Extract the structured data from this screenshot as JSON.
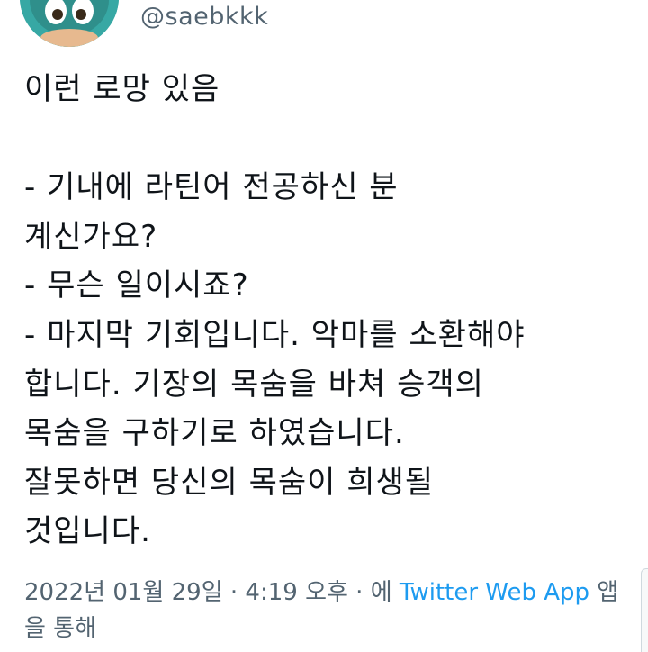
{
  "author": {
    "handle": "@saebkkk",
    "avatar_icon": "profile-avatar-icon"
  },
  "tweet": {
    "text": "이런 로망 있음\n\n- 기내에 라틴어 전공하신 분\n계신가요?\n- 무슨 일이시죠?\n- 마지막 기회입니다. 악마를 소환해야\n합니다. 기장의 목숨을 바쳐 승객의\n목숨을 구하기로 하였습니다.\n잘못하면 당신의 목숨이 희생될\n것입니다."
  },
  "meta": {
    "timestamp": "2022년 01월 29일 · 4:19 오후 · ",
    "via_prefix": "에 ",
    "source_app": "Twitter Web App",
    "via_suffix": " 앱을 통해"
  },
  "colors": {
    "text": "#0f1419",
    "secondary": "#536471",
    "link": "#1d9bf0",
    "avatar_bg": "#37a8a4"
  }
}
